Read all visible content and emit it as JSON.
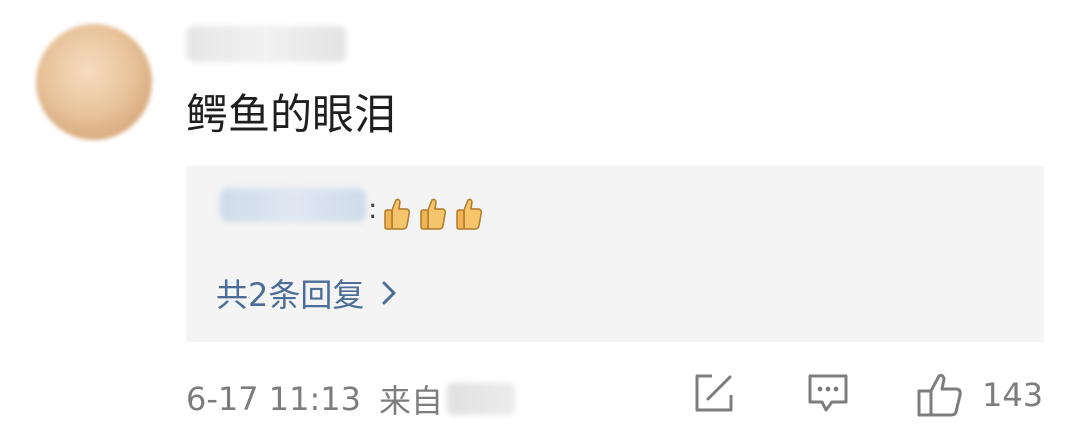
{
  "comment": {
    "text": "鳄鱼的眼泪",
    "timestamp": "6-17 11:13",
    "source_prefix": "来自"
  },
  "reply_preview": {
    "separator": ":",
    "emojis": [
      "thumbs-up",
      "thumbs-up",
      "thumbs-up"
    ],
    "count_label": "共2条回复"
  },
  "actions": {
    "like_count": "143"
  },
  "colors": {
    "link": "#4c6d98",
    "meta": "#7d7d7d",
    "reply_bg": "#f4f4f4"
  }
}
